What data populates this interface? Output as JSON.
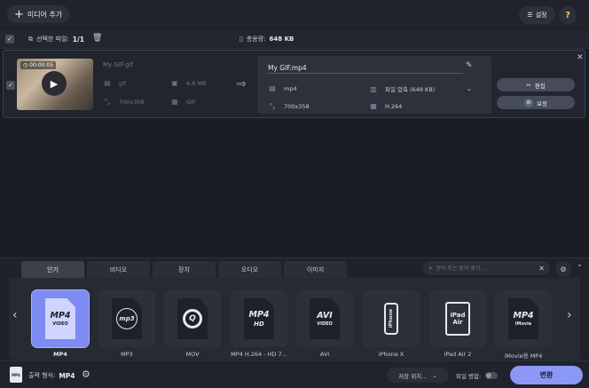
{
  "toolbar": {
    "add_media_label": "미디어 추가",
    "settings_label": "설정",
    "help_label": "?"
  },
  "selection": {
    "label": "선택한 파일:",
    "count": "1/1",
    "total_label": "총용량:",
    "total_value": "648 KB"
  },
  "file": {
    "duration": "00:00:05",
    "source": {
      "name": "My GIF.gif",
      "format": "gif",
      "size": "6.8 MB",
      "resolution": "700x358",
      "codec": "GIF"
    },
    "target": {
      "name": "My GIF.mp4",
      "format": "mp4",
      "compression": "파일 압축 (648 KB)",
      "resolution": "700x358",
      "codec": "H.264"
    },
    "edit_label": "편집",
    "subtitle_label": "보정",
    "ai_badge": "AI"
  },
  "format_tabs": [
    {
      "label": "인기"
    },
    {
      "label": "비디오"
    },
    {
      "label": "장치"
    },
    {
      "label": "오디오"
    },
    {
      "label": "이미지"
    }
  ],
  "search": {
    "placeholder": "형식 또는 장치 찾기..."
  },
  "formats": [
    {
      "main": "MP4",
      "sub": "VIDEO",
      "label": "MP4"
    },
    {
      "main": "mp3",
      "sub": "",
      "label": "MP3"
    },
    {
      "main": "Q",
      "sub": "",
      "label": "MOV"
    },
    {
      "main": "MP4",
      "sub": "HD",
      "label": "MP4 H.264 - HD 7..."
    },
    {
      "main": "AVI",
      "sub": "VIDEO",
      "label": "AVI"
    },
    {
      "main": "iPhone",
      "sub": "",
      "label": "iPhone X"
    },
    {
      "main": "iPad",
      "sub": "Air",
      "label": "iPad Air 2"
    },
    {
      "main": "MP4",
      "sub": "iMovie",
      "label": "iMovie용 MP4"
    }
  ],
  "output": {
    "label": "출력 형식:",
    "value": "MP4",
    "icon_text": "MP4"
  },
  "save": {
    "label": "저장 위치...",
    "merge_label": "파일 병합:",
    "convert_label": "변환"
  }
}
